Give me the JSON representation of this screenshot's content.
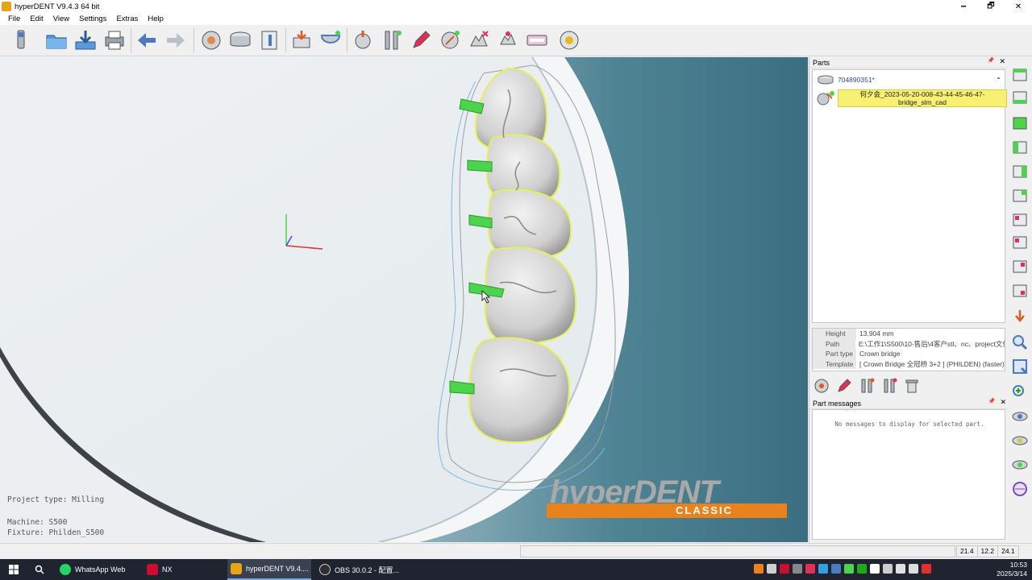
{
  "window": {
    "title": "hyperDENT V9.4.3 64 bit",
    "controls": {
      "minimize": "🗕",
      "maximize": "🗗",
      "close": "✕"
    }
  },
  "menu": [
    "File",
    "Edit",
    "View",
    "Settings",
    "Extras",
    "Help"
  ],
  "toolbar": {
    "buttons": [
      "tool-icon",
      "open-folder-icon",
      "download-icon",
      "print-icon",
      "back-arrow-icon",
      "forward-arrow-icon",
      "blank-icon",
      "stock-disc-icon",
      "fixture-icon",
      "add-part-icon",
      "blank-holder-icon",
      "prep-icon",
      "tool-holders-icon",
      "pen-icon",
      "calculate-icon",
      "simulate-icon",
      "check-icon",
      "postprocessor-icon",
      "report-icon"
    ]
  },
  "viewport": {
    "project_type": "Project type: Milling",
    "machine": "Machine: S500",
    "fixture": "Fixture: Philden_S500",
    "brand": {
      "name": "hyperDENT",
      "edition": "CLASSIC"
    }
  },
  "parts_panel": {
    "title": "Parts",
    "pin": "📌",
    "close": "✕",
    "blank_id": "704890351*",
    "part_name_line1": "何夕会_2023-05-20-008-43-44-45-46-47-",
    "part_name_line2": "bridge_slm_cad",
    "properties": [
      {
        "key": "Height",
        "value": "13.904 mm"
      },
      {
        "key": "Path",
        "value": "E:\\工作1\\S500\\10-售后\\4客户stl、nc、project文件"
      },
      {
        "key": "Part type",
        "value": "Crown bridge"
      },
      {
        "key": "Template",
        "value": "[ Crown Bridge 全冠桥 3+2 ] (PHILDEN) (faster)"
      }
    ]
  },
  "messages_panel": {
    "title": "Part messages",
    "empty_text": "No messages to display for selected part."
  },
  "statusbar": {
    "coords": [
      "21.4",
      "12.2",
      "24.1"
    ]
  },
  "taskbar": {
    "apps": [
      {
        "label": "WhatsApp Web",
        "color": "#25d366"
      },
      {
        "label": "NX",
        "color": "#c8102e"
      },
      {
        "label": "hyperDENT V9.4....",
        "color": "#e8a417"
      },
      {
        "label": "OBS 30.0.2 - 配置...",
        "color": "#302e31"
      }
    ],
    "time": "10:53",
    "date": "2025/3/14"
  },
  "colors": {
    "accent": "#e9821c",
    "selection": "#f8f070",
    "marker": "#4cd44c"
  }
}
